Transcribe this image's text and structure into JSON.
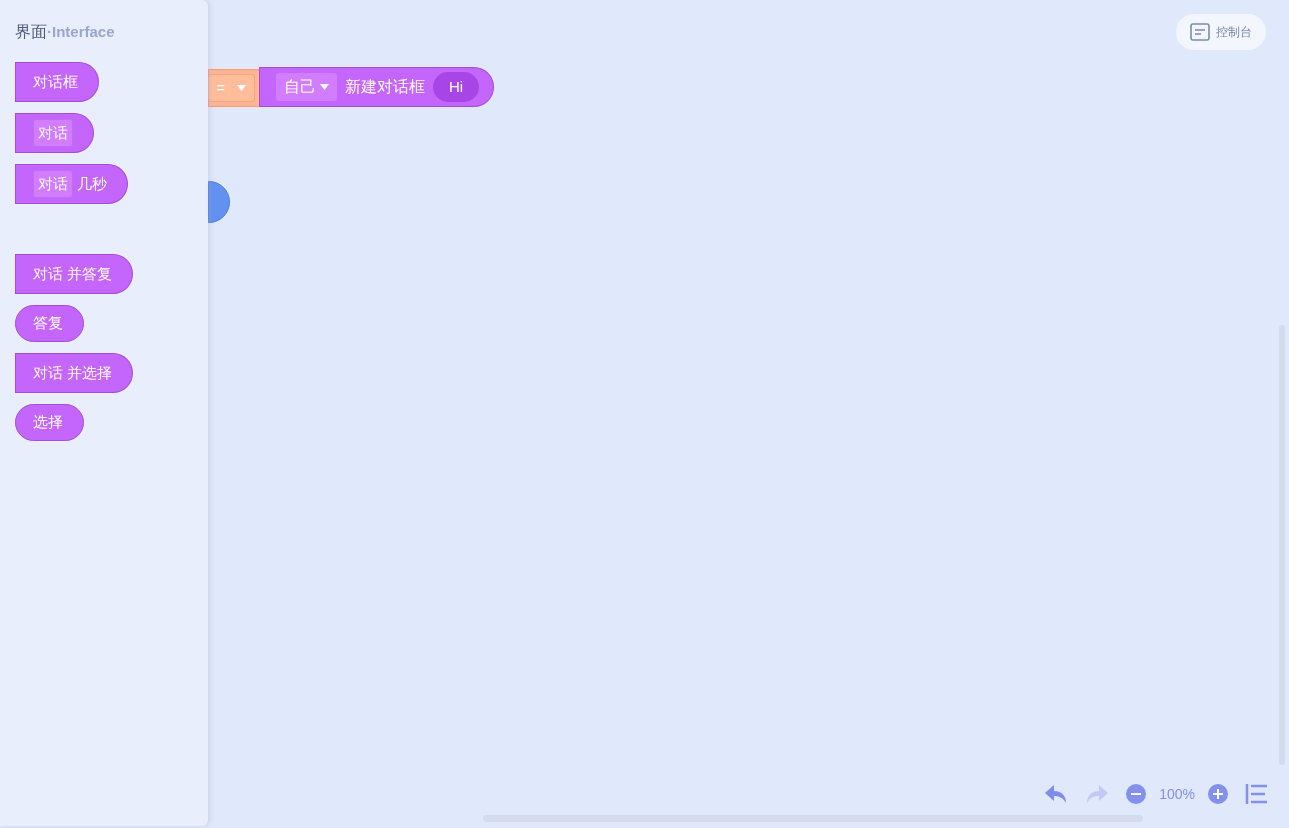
{
  "flyout": {
    "title": "界面",
    "subtitle": "·Interface",
    "groups": [
      {
        "blocks": [
          {
            "kind": "command",
            "parts": [
              {
                "kind": "text",
                "text": "对话框"
              }
            ]
          },
          {
            "kind": "command",
            "parts": [
              {
                "kind": "slot",
                "text": "对话"
              }
            ]
          },
          {
            "kind": "command",
            "parts": [
              {
                "kind": "slot",
                "text": "对话"
              },
              {
                "kind": "text",
                "text": "几秒"
              }
            ]
          }
        ]
      },
      {
        "blocks": [
          {
            "kind": "command",
            "parts": [
              {
                "kind": "text",
                "text": "对话 并答复"
              }
            ]
          },
          {
            "kind": "reporter",
            "parts": [
              {
                "kind": "text",
                "text": "答复"
              }
            ]
          },
          {
            "kind": "command",
            "parts": [
              {
                "kind": "text",
                "text": "对话 并选择"
              }
            ]
          },
          {
            "kind": "reporter",
            "parts": [
              {
                "kind": "text",
                "text": "选择"
              }
            ]
          }
        ]
      }
    ]
  },
  "canvas": {
    "operator_block": {
      "operator": "="
    },
    "dialog_block": {
      "target": "自己",
      "label": "新建对话框",
      "message": "Hi"
    }
  },
  "console_button": {
    "label": "控制台"
  },
  "zoom_controls": {
    "undo_disabled": false,
    "redo_disabled": true,
    "zoom": "100%"
  }
}
